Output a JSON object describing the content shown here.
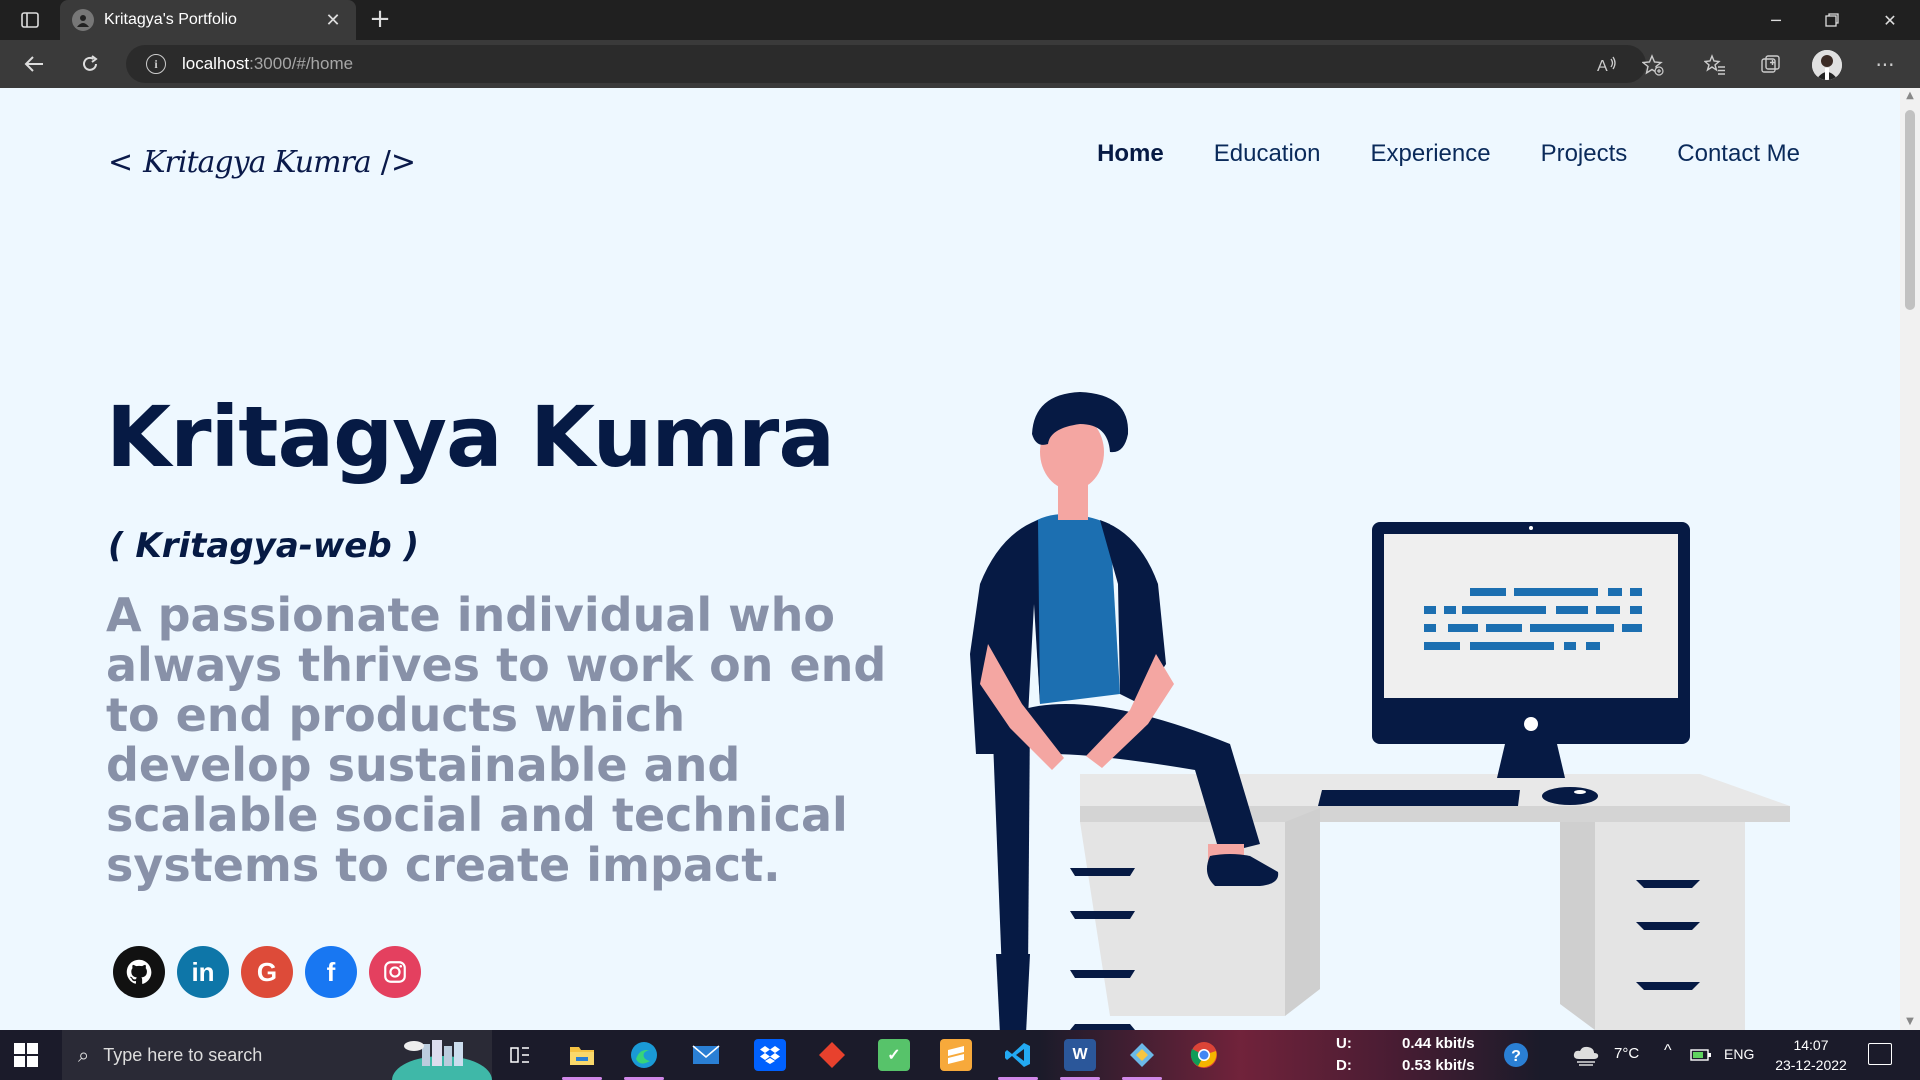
{
  "browser": {
    "tab_title": "Kritagya's Portfolio",
    "url_host": "localhost",
    "url_path": ":3000/#/home"
  },
  "site": {
    "logo_open": "<",
    "logo_signature": "Kritagya Kumra",
    "logo_close": "/>",
    "nav": [
      "Home",
      "Education",
      "Experience",
      "Projects",
      "Contact Me"
    ],
    "active_nav": "Home",
    "hero_name": "Kritagya Kumra",
    "hero_handle": "( Kritagya-web )",
    "hero_description": "A passionate individual who always thrives to work on end to end products which develop sustainable and scalable social and technical systems to create impact.",
    "social": [
      {
        "name": "github",
        "glyph": "",
        "color": "#111111"
      },
      {
        "name": "linkedin",
        "glyph": "in",
        "color": "#0e76a8"
      },
      {
        "name": "google",
        "glyph": "G",
        "color": "#dd4b39"
      },
      {
        "name": "facebook",
        "glyph": "f",
        "color": "#1877f2"
      },
      {
        "name": "instagram",
        "glyph": "",
        "color": "#e4405f"
      }
    ]
  },
  "taskbar": {
    "search_placeholder": "Type here to search",
    "net_up_label": "U:",
    "net_up_value": "0.44 kbit/s",
    "net_down_label": "D:",
    "net_down_value": "0.53 kbit/s",
    "temperature": "7°C",
    "language": "ENG",
    "time": "14:07",
    "date": "23-12-2022"
  },
  "colors": {
    "page_bg": "#eef8ff",
    "navy": "#061a44",
    "desc_gray": "#8891a8"
  }
}
